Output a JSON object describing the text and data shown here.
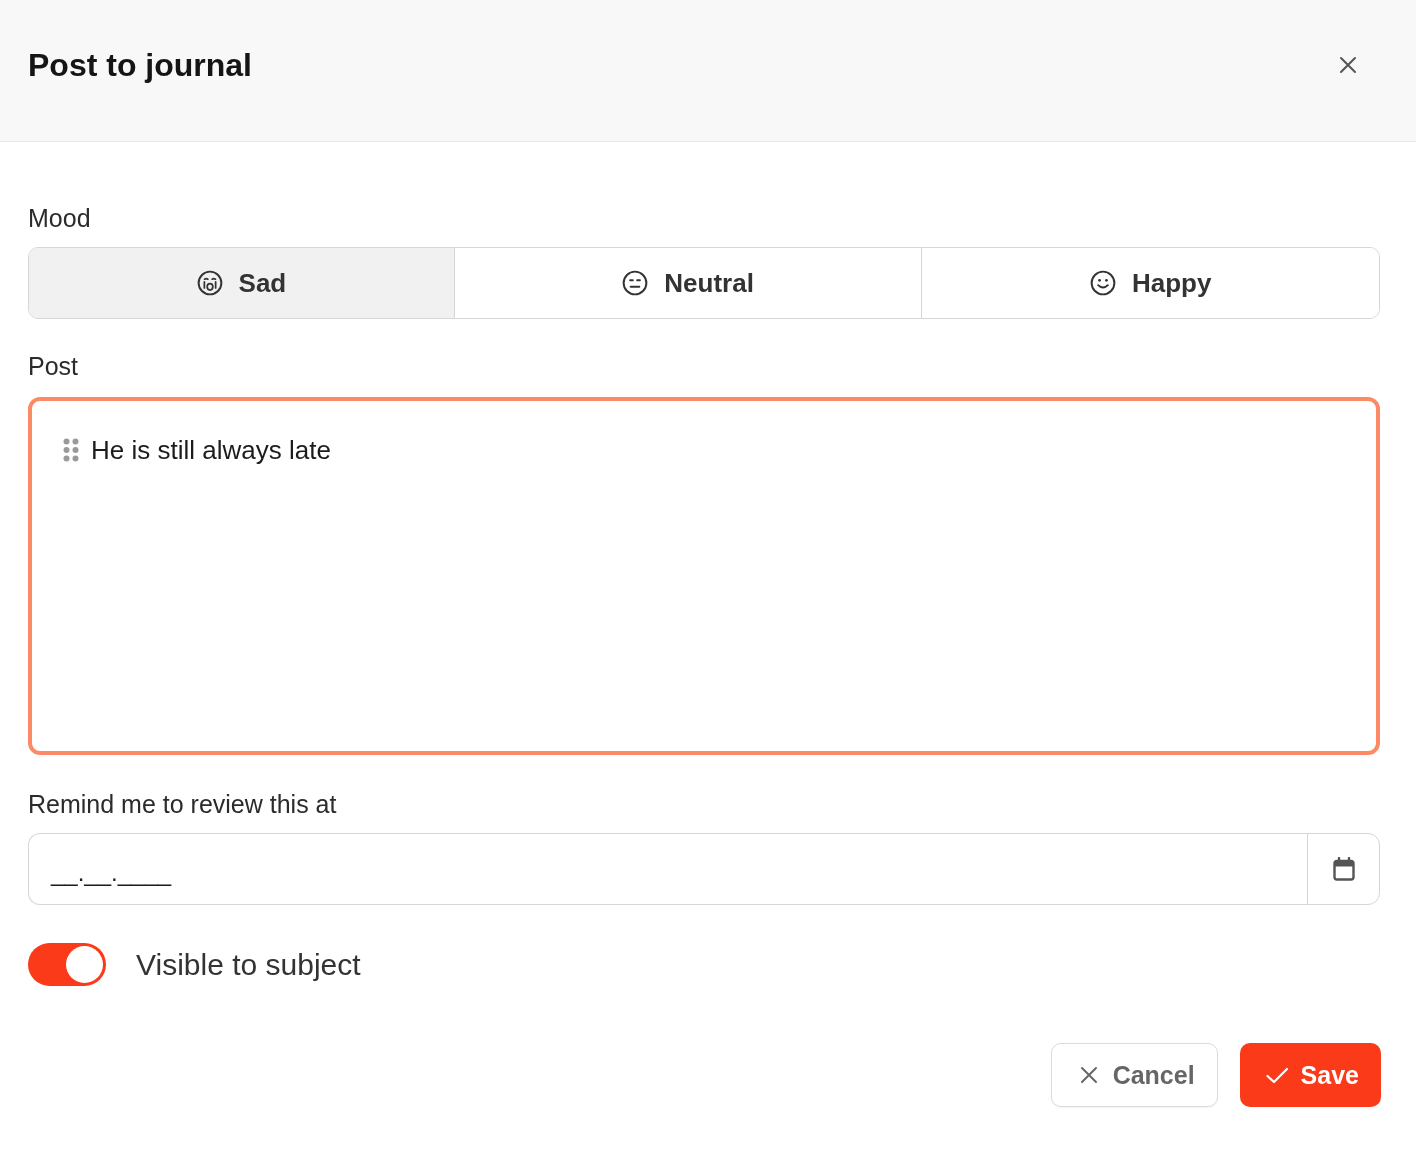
{
  "dialog": {
    "title": "Post to journal"
  },
  "mood": {
    "label": "Mood",
    "options": [
      {
        "label": "Sad",
        "kind": "sad",
        "selected": true
      },
      {
        "label": "Neutral",
        "kind": "neutral",
        "selected": false
      },
      {
        "label": "Happy",
        "kind": "happy",
        "selected": false
      }
    ]
  },
  "post": {
    "label": "Post",
    "value": "He is still always late",
    "focused": true
  },
  "reminder": {
    "label": "Remind me to review this at",
    "value": "__.__.____"
  },
  "visible_to_subject": {
    "label": "Visible to subject",
    "on": true
  },
  "buttons": [
    {
      "label": "Cancel",
      "kind": "cancel"
    },
    {
      "label": "Save",
      "kind": "save"
    }
  ]
}
